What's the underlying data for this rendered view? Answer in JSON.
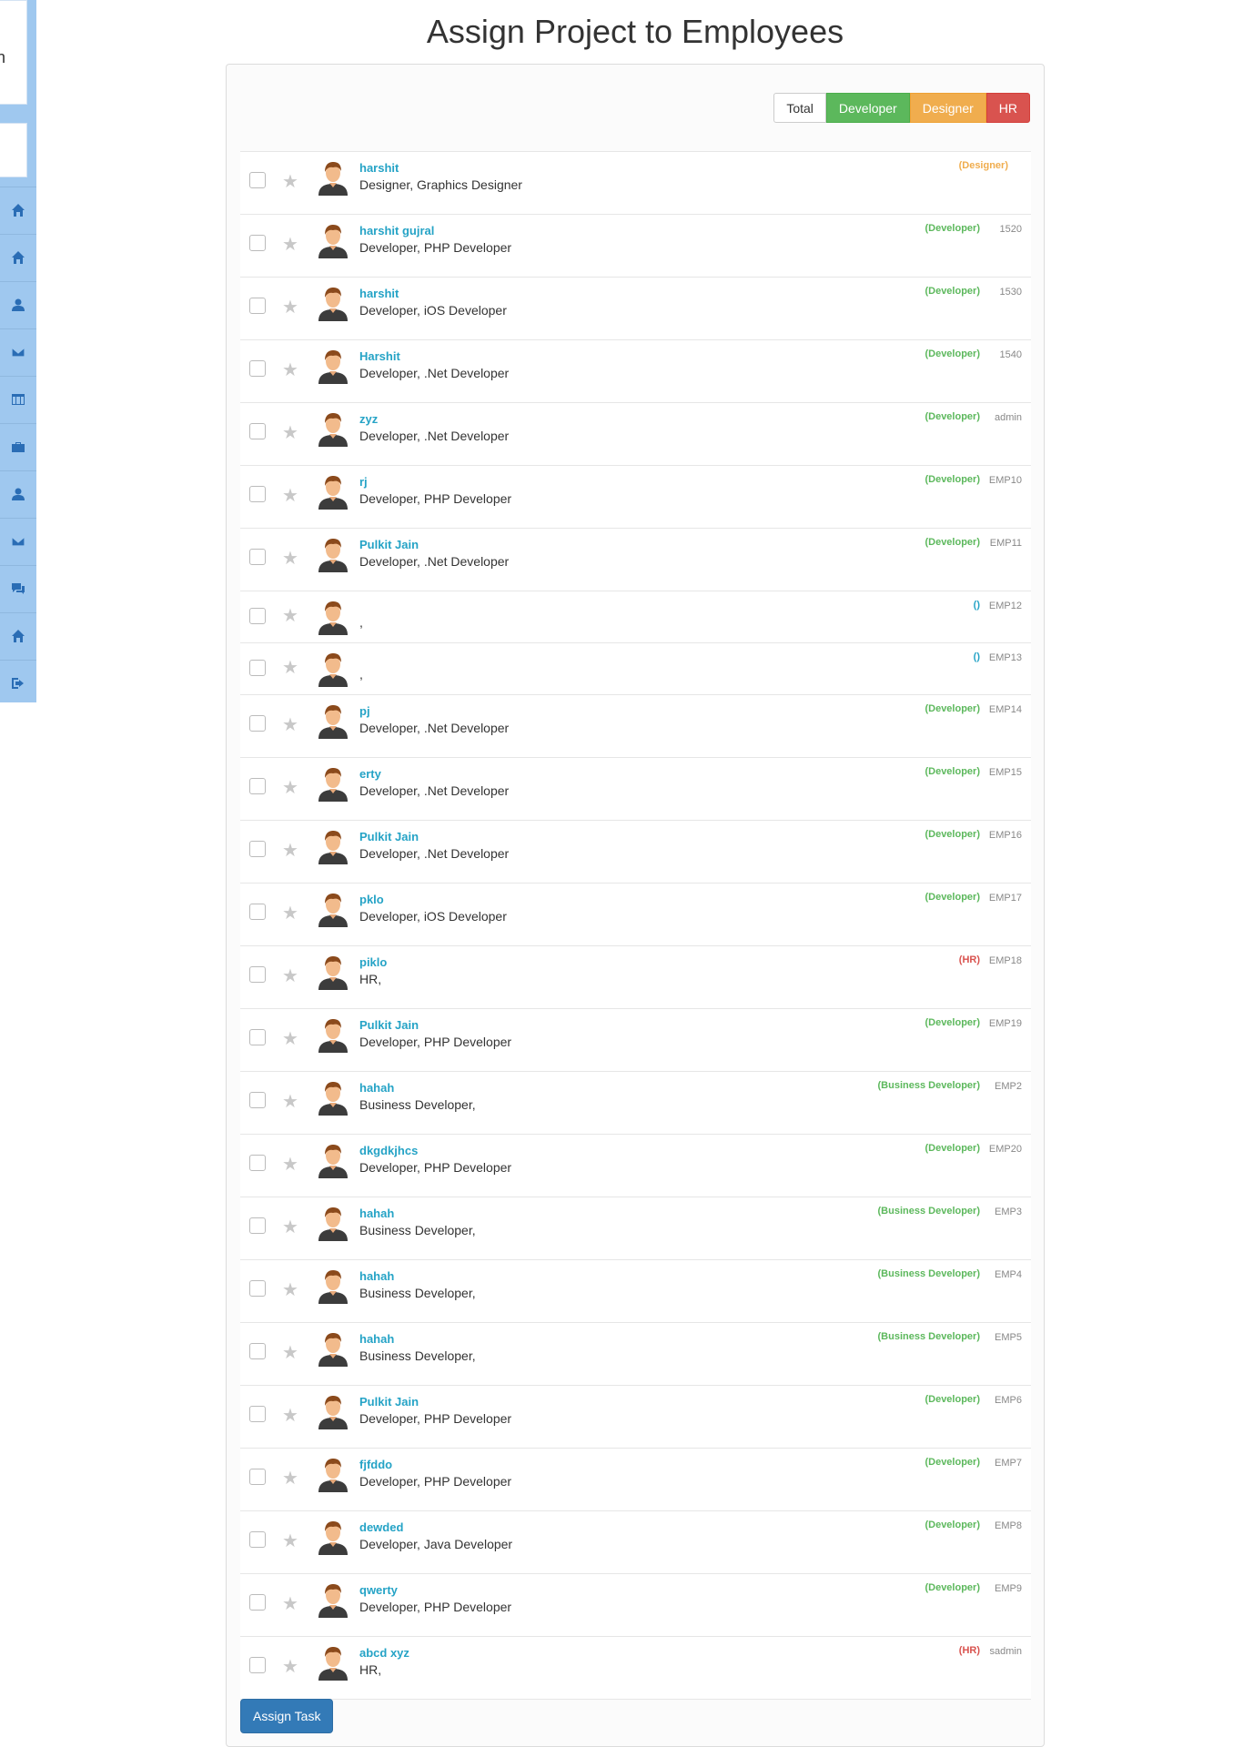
{
  "page": {
    "title": "Assign Project to Employees"
  },
  "sidebar": {
    "box_text": "n",
    "items": [
      {
        "icon": "home-icon"
      },
      {
        "icon": "home-icon"
      },
      {
        "icon": "user-icon"
      },
      {
        "icon": "envelope-icon"
      },
      {
        "icon": "table-icon"
      },
      {
        "icon": "briefcase-icon"
      },
      {
        "icon": "user-icon"
      },
      {
        "icon": "envelope-icon"
      },
      {
        "icon": "comments-icon"
      },
      {
        "icon": "home-icon"
      },
      {
        "icon": "logout-icon"
      }
    ]
  },
  "filters": {
    "total": "Total",
    "developer": "Developer",
    "designer": "Designer",
    "hr": "HR"
  },
  "colors": {
    "developer": "#5cb85c",
    "designer": "#f0ad4e",
    "hr": "#d9534f",
    "name_link": "#25a3c6",
    "primary": "#337ab7"
  },
  "employees": [
    {
      "name": "harshit",
      "desc": "Designer, Graphics Designer",
      "role": "(Designer)",
      "role_type": "des",
      "code": ""
    },
    {
      "name": "harshit gujral",
      "desc": "Developer, PHP Developer",
      "role": "(Developer)",
      "role_type": "dev",
      "code": "1520"
    },
    {
      "name": "harshit",
      "desc": "Developer, iOS Developer",
      "role": "(Developer)",
      "role_type": "dev",
      "code": "1530"
    },
    {
      "name": "Harshit",
      "desc": "Developer, .Net Developer",
      "role": "(Developer)",
      "role_type": "dev",
      "code": "1540"
    },
    {
      "name": "zyz",
      "desc": "Developer, .Net Developer",
      "role": "(Developer)",
      "role_type": "dev",
      "code": "admin"
    },
    {
      "name": "rj",
      "desc": "Developer, PHP Developer",
      "role": "(Developer)",
      "role_type": "dev",
      "code": "EMP10"
    },
    {
      "name": "Pulkit Jain",
      "desc": "Developer, .Net Developer",
      "role": "(Developer)",
      "role_type": "dev",
      "code": "EMP11"
    },
    {
      "name": "",
      "desc": ",",
      "role": "()",
      "role_type": "empty",
      "code": "EMP12",
      "short": true
    },
    {
      "name": "",
      "desc": ",",
      "role": "()",
      "role_type": "empty",
      "code": "EMP13",
      "short": true
    },
    {
      "name": "pj",
      "desc": "Developer, .Net Developer",
      "role": "(Developer)",
      "role_type": "dev",
      "code": "EMP14"
    },
    {
      "name": "erty",
      "desc": "Developer, .Net Developer",
      "role": "(Developer)",
      "role_type": "dev",
      "code": "EMP15"
    },
    {
      "name": "Pulkit Jain",
      "desc": "Developer, .Net Developer",
      "role": "(Developer)",
      "role_type": "dev",
      "code": "EMP16"
    },
    {
      "name": "pklo",
      "desc": "Developer, iOS Developer",
      "role": "(Developer)",
      "role_type": "dev",
      "code": "EMP17"
    },
    {
      "name": "piklo",
      "desc": "HR,",
      "role": "(HR)",
      "role_type": "hr",
      "code": "EMP18"
    },
    {
      "name": "Pulkit Jain",
      "desc": "Developer, PHP Developer",
      "role": "(Developer)",
      "role_type": "dev",
      "code": "EMP19"
    },
    {
      "name": "hahah",
      "desc": "Business Developer,",
      "role": "(Business Developer)",
      "role_type": "dev",
      "code": "EMP2"
    },
    {
      "name": "dkgdkjhcs",
      "desc": "Developer, PHP Developer",
      "role": "(Developer)",
      "role_type": "dev",
      "code": "EMP20"
    },
    {
      "name": "hahah",
      "desc": "Business Developer,",
      "role": "(Business Developer)",
      "role_type": "dev",
      "code": "EMP3"
    },
    {
      "name": "hahah",
      "desc": "Business Developer,",
      "role": "(Business Developer)",
      "role_type": "dev",
      "code": "EMP4"
    },
    {
      "name": "hahah",
      "desc": "Business Developer,",
      "role": "(Business Developer)",
      "role_type": "dev",
      "code": "EMP5"
    },
    {
      "name": "Pulkit Jain",
      "desc": "Developer, PHP Developer",
      "role": "(Developer)",
      "role_type": "dev",
      "code": "EMP6"
    },
    {
      "name": "fjfddo",
      "desc": "Developer, PHP Developer",
      "role": "(Developer)",
      "role_type": "dev",
      "code": "EMP7"
    },
    {
      "name": "dewded",
      "desc": "Developer, Java Developer",
      "role": "(Developer)",
      "role_type": "dev",
      "code": "EMP8"
    },
    {
      "name": "qwerty",
      "desc": "Developer, PHP Developer",
      "role": "(Developer)",
      "role_type": "dev",
      "code": "EMP9"
    },
    {
      "name": "abcd xyz",
      "desc": "HR,",
      "role": "(HR)",
      "role_type": "hr",
      "code": "sadmin"
    }
  ],
  "actions": {
    "assign_label": "Assign Task"
  }
}
